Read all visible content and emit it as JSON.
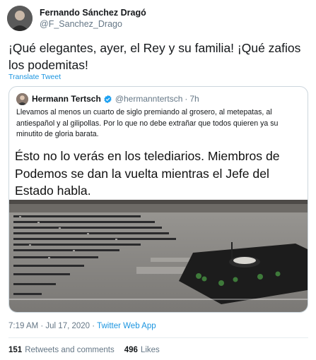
{
  "author": {
    "display_name": "Fernando Sánchez Dragó",
    "handle": "@F_Sanchez_Drago"
  },
  "tweet": {
    "text": "¡Qué elegantes, ayer, el Rey y su familia! ¡Qué zafios los podemitas!",
    "translate_label": "Translate Tweet"
  },
  "quoted": {
    "display_name": "Hermann Tertsch",
    "handle": "@hermanntertsch",
    "separator": "·",
    "time": "7h",
    "text": "Llevamos al menos un cuarto de siglo premiando al grosero, al metepatas, al antiespañol y al gilipollas. Por lo que no debe extrañar que todos quieren ya su minutito de gloria barata.",
    "media_caption": "Ésto no lo verás en los telediarios. Miembros de Podemos se dan la vuelta  mientras el Jefe del Estado habla."
  },
  "meta": {
    "time_date": "7:19 AM · Jul 17, 2020 · ",
    "source": "Twitter Web App"
  },
  "stats": {
    "retweets_count": "151",
    "retweets_label": "Retweets and comments",
    "likes_count": "496",
    "likes_label": "Likes"
  },
  "colors": {
    "link": "#1b95e0",
    "secondary_text": "#657786",
    "verified": "#1da1f2"
  }
}
